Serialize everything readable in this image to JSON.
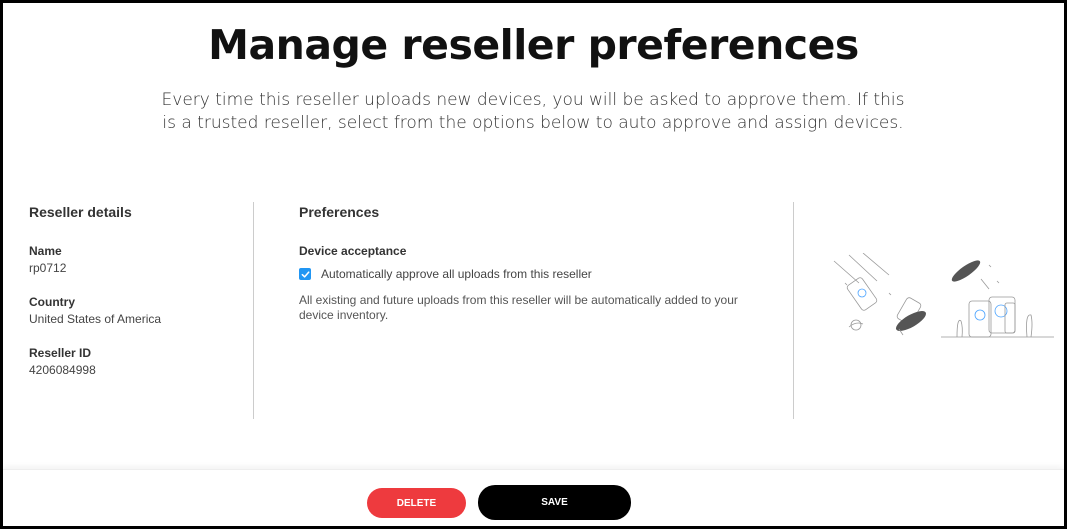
{
  "header": {
    "title": "Manage reseller preferences",
    "subtitle": "Every time this reseller uploads new devices, you will be asked to approve them. If this is a trusted reseller, select from the options below to auto approve and assign devices."
  },
  "reseller_details": {
    "heading": "Reseller details",
    "fields": [
      {
        "label": "Name",
        "value": "rp0712"
      },
      {
        "label": "Country",
        "value": "United States of America"
      },
      {
        "label": "Reseller ID",
        "value": "4206084998"
      }
    ]
  },
  "preferences": {
    "heading": "Preferences",
    "device_acceptance_label": "Device acceptance",
    "auto_approve": {
      "checked": true,
      "label": "Automatically approve all uploads from this reseller"
    },
    "note": "All existing and future uploads from this reseller will be automatically added to your device inventory."
  },
  "illustration": {
    "icon": "device-upload-illustration"
  },
  "footer": {
    "delete_label": "DELETE",
    "save_label": "SAVE"
  },
  "colors": {
    "accent_blue": "#2196f3",
    "delete_red": "#ee3a3e",
    "save_black": "#000000"
  }
}
